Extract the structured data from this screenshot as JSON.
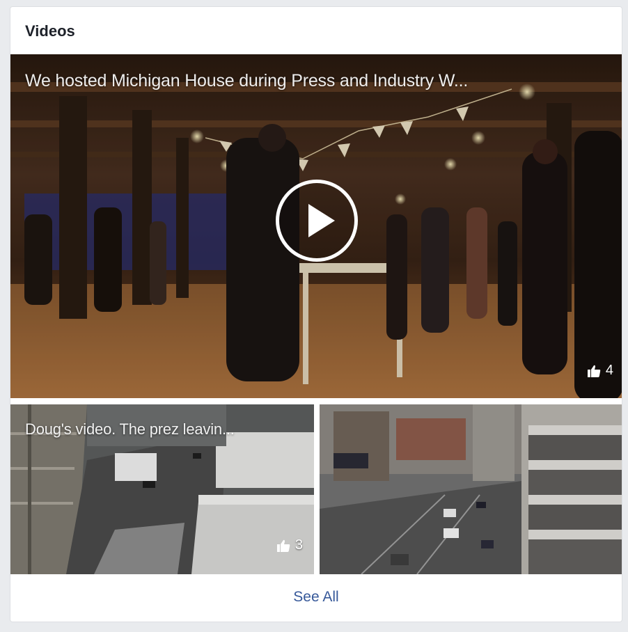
{
  "section": {
    "title": "Videos",
    "see_all_label": "See All"
  },
  "videos": [
    {
      "caption": "We hosted Michigan House during Press and Industry W...",
      "likes": "4",
      "scene": "event-hall"
    },
    {
      "caption": "Doug's video. The prez leavin...",
      "likes": "3",
      "scene": "street-aerial"
    },
    {
      "caption": "",
      "likes": "",
      "scene": "city-intersection"
    }
  ],
  "icons": {
    "play": "play-icon",
    "like": "thumbs-up-icon"
  },
  "colors": {
    "link": "#365899",
    "title": "#1d2129",
    "background": "#e9ebee"
  }
}
